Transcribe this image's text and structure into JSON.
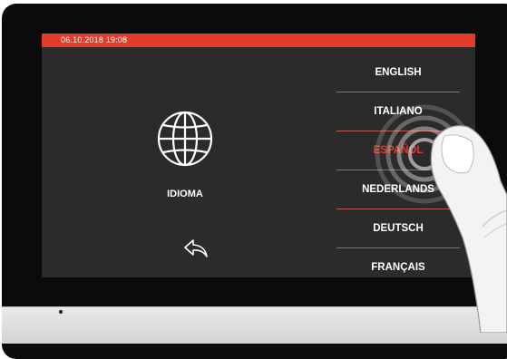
{
  "status": {
    "datetime": "06.10.2018   19:08"
  },
  "main": {
    "section_label": "IDIOMA",
    "globe_icon": "globe-icon",
    "back_icon": "back-arrow-icon"
  },
  "languages": {
    "items": [
      {
        "label": "ENGLISH"
      },
      {
        "label": "ITALIANO"
      },
      {
        "label": "ESPAÑOL"
      },
      {
        "label": "NEDERLANDS"
      },
      {
        "label": "DEUTSCH"
      },
      {
        "label": "FRANÇAIS"
      }
    ],
    "selected": "ESPAÑOL"
  },
  "colors": {
    "accent": "#e23b2a",
    "screen_bg": "#2b2b2b",
    "bezel": "#0b0b0b",
    "text": "#ffffff"
  }
}
